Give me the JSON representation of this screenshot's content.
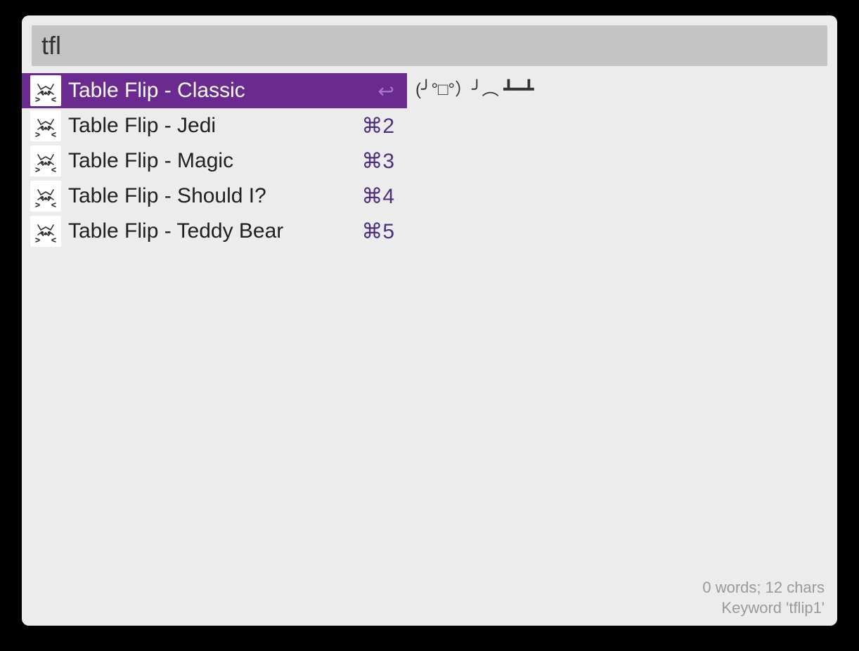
{
  "search": {
    "value": "tfl"
  },
  "results": [
    {
      "label": "Table Flip - Classic",
      "shortcut": "↩",
      "selected": true
    },
    {
      "label": "Table Flip - Jedi",
      "shortcut": "⌘2",
      "selected": false
    },
    {
      "label": "Table Flip - Magic",
      "shortcut": "⌘3",
      "selected": false
    },
    {
      "label": "Table Flip - Should I?",
      "shortcut": "⌘4",
      "selected": false
    },
    {
      "label": "Table Flip - Teddy Bear",
      "shortcut": "⌘5",
      "selected": false
    }
  ],
  "preview": {
    "text": "(╯°□°）╯︵ ┻━┻"
  },
  "meta": {
    "stats": "0 words; 12 chars",
    "keyword": "Keyword 'tflip1'"
  }
}
